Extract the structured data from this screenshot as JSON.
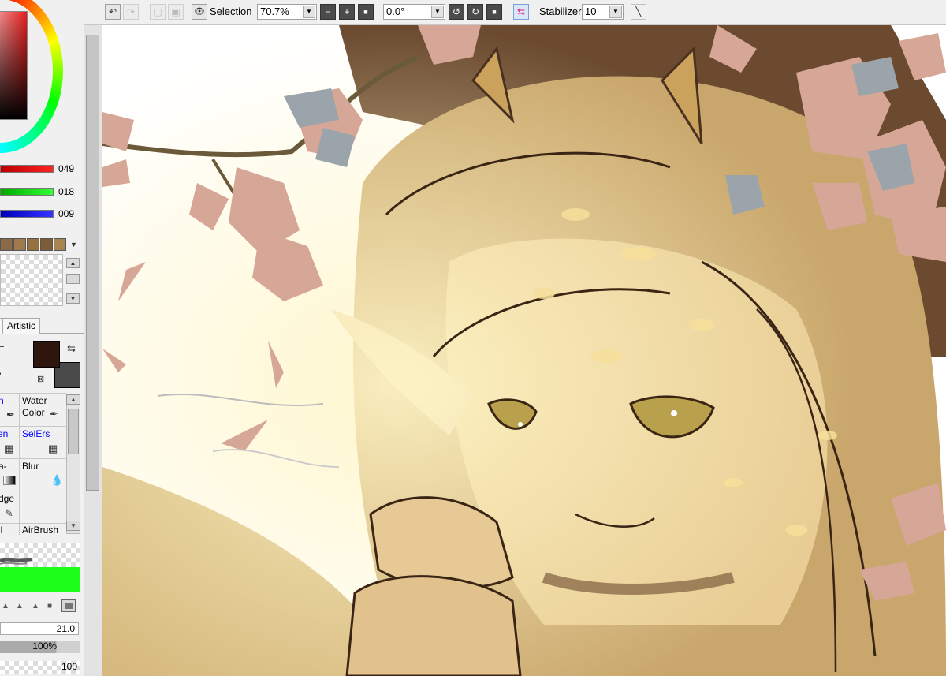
{
  "toolbar": {
    "selection_label": "Selection",
    "zoom_value": "70.7%",
    "rotation_value": "0.0°",
    "stabilizer_label": "Stabilizer",
    "stabilizer_value": "10"
  },
  "color_panel": {
    "rgb_values": [
      "049",
      "018",
      "009"
    ],
    "primary_color": "#2e160e",
    "secondary_color": "#4a4a4a",
    "swatch_colors": [
      "#8b6a46",
      "#a0794c",
      "#96703e",
      "#7d5c3a",
      "#a78552"
    ]
  },
  "panel_tabs": {
    "artistic_label": "Artistic"
  },
  "tools": {
    "row1_left": "n",
    "row1_right_line1": "Water",
    "row1_right_line2": "Color",
    "row2_left": "en",
    "row2_right": "SelErs",
    "row3_left": "a-",
    "row3_right": "Blur",
    "row4_left": "dge",
    "row5_left": "il",
    "row5_right": "AirBrush"
  },
  "brush_settings": {
    "size_value": "21.0",
    "opacity_value": "100%",
    "density_value": "100"
  }
}
